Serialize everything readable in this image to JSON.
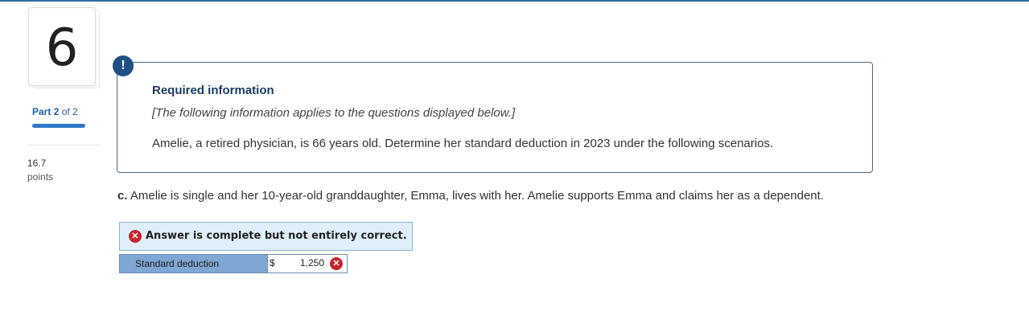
{
  "question": {
    "number": "6"
  },
  "part": {
    "label": "Part",
    "current": "2",
    "of_text": "of 2",
    "progress_fraction": 1.0
  },
  "points": {
    "value": "16.7",
    "label": "points"
  },
  "info": {
    "title": "Required information",
    "italic_note": "[The following information applies to the questions displayed below.]",
    "body": "Amelie, a retired physician, is 66 years old. Determine her standard deduction in 2023 under the following scenarios."
  },
  "question_text": {
    "prefix": "c.",
    "text": "Amelie is single and her 10-year-old granddaughter, Emma, lives with her. Amelie supports Emma and claims her as a dependent."
  },
  "feedback": {
    "banner": "Answer is complete but not entirely correct."
  },
  "answer_row": {
    "label": "Standard deduction",
    "currency": "$",
    "value": "1,250",
    "status": "incorrect"
  },
  "colors": {
    "accent": "#1f5fa8",
    "error": "#c9252c",
    "banner_bg": "#dfeffa",
    "label_bg": "#7fa7d3"
  },
  "icons": {
    "alert": "exclamation-icon",
    "error": "x-circle-icon"
  }
}
